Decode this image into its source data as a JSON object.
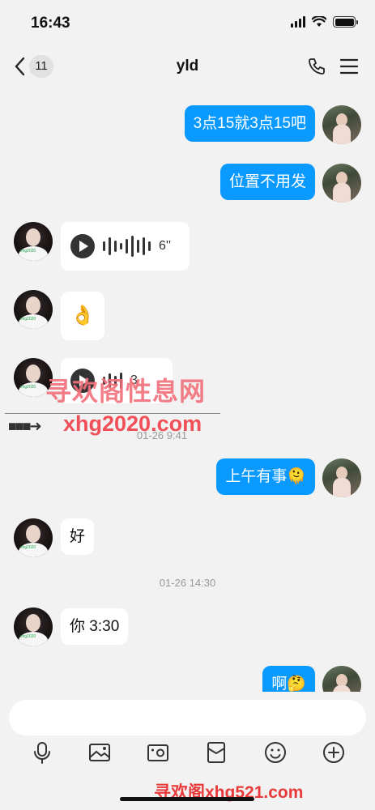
{
  "status": {
    "time": "16:43"
  },
  "nav": {
    "back_count": "11",
    "title": "yld"
  },
  "messages": {
    "m1": "3点15就3点15吧",
    "m2": "位置不用发",
    "m3_duration": "6''",
    "m4": "👌",
    "m5_duration": "3",
    "ts1": "01-26 9:41",
    "m6": "上午有事🫠",
    "m7": "好",
    "ts2": "01-26 14:30",
    "m8": "你 3:30",
    "m9": "啊🤔"
  },
  "avatar_watermark": "xhg2020",
  "watermarks": {
    "cn": "寻欢阁性息网",
    "url": "xhg2020.com",
    "bottom": "寻欢阁xhg521.com"
  },
  "input": {
    "placeholder": ""
  },
  "colors": {
    "self_bubble": "#0a99ff",
    "other_bubble": "#ffffff",
    "background": "#f2f2f2"
  },
  "icons": [
    "chevron-left-icon",
    "phone-icon",
    "menu-icon",
    "microphone-icon",
    "image-icon",
    "camera-icon",
    "red-packet-icon",
    "emoji-icon",
    "plus-icon"
  ]
}
